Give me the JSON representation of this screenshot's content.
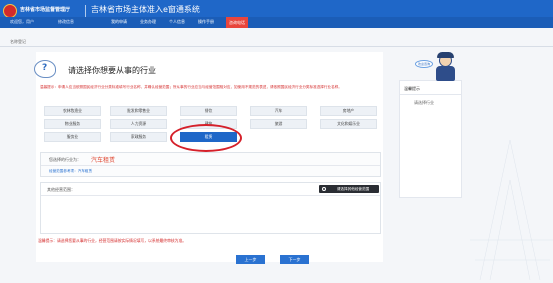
{
  "header": {
    "agency": "吉林省市场监督管理厅",
    "system": "吉林省市场主体准入e窗通系统",
    "user": "欢迎您，用户",
    "change_info": "修改信息",
    "nav": [
      "我的申请",
      "业务办理",
      "个人信息",
      "操作手册",
      "咨询电话"
    ],
    "active_nav": "咨询电话"
  },
  "breadcrumb": "名称登记",
  "page_title": "请选择你想要从事的行业",
  "warning": "温馨提示：申请人应当依照国民经济行业分类标准填写行业名称，并确认经营范围；所从事的行业应当与经营范围相对应，如使用不规范的表述，请依照国民经济行业分类标准选择行业名称。",
  "industries": [
    [
      "农林牧渔业",
      "批发和零售业",
      "餐饮",
      "汽车",
      "房地产"
    ],
    [
      "物业服务",
      "人力资源",
      "建筑",
      "旅游",
      "文化和娱乐业"
    ],
    [
      "服务业",
      "家政服务",
      "租赁"
    ]
  ],
  "selected_industry": "租赁",
  "selection": {
    "label": "您选择的行业为：",
    "value": "汽车租赁",
    "scope_link": "经营范围参考项：汽车租赁"
  },
  "scope": {
    "label": "其他经营范围：",
    "button": "请选择其他经营范围"
  },
  "bottom_warning": "温馨提示：请选择您要从事的行业，经营范围请按实际情况填写，以系统最终审核为准。",
  "buttons": {
    "prev": "上一步",
    "next": "下一步"
  },
  "tips": {
    "header": "温馨提示",
    "body": "请选择行业"
  },
  "mascot_bubble": "欢迎咨询",
  "colors": {
    "header": "#1f67c8",
    "active_nav": "#e8453c",
    "selected": "#1f67c8",
    "highlight": "#d5202a",
    "warning": "#d42c2c"
  }
}
